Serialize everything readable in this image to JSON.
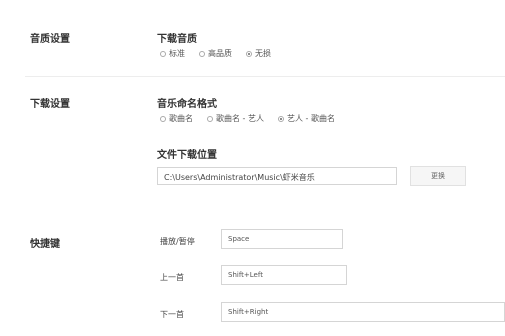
{
  "audio_quality": {
    "section_title": "音质设置",
    "subtitle": "下载音质",
    "options": [
      {
        "label": "标准",
        "checked": false
      },
      {
        "label": "高品质",
        "checked": false
      },
      {
        "label": "无损",
        "checked": true
      }
    ]
  },
  "download": {
    "section_title": "下载设置",
    "naming_title": "音乐命名格式",
    "naming_options": [
      {
        "label": "歌曲名",
        "checked": false
      },
      {
        "label": "歌曲名 - 艺人",
        "checked": false
      },
      {
        "label": "艺人 - 歌曲名",
        "checked": true
      }
    ],
    "location_title": "文件下载位置",
    "path": "C:\\Users\\Administrator\\Music\\虾米音乐",
    "change_label": "更换"
  },
  "shortcuts": {
    "section_title": "快捷键",
    "items": [
      {
        "label": "播放/暂停",
        "value": "Space"
      },
      {
        "label": "上一首",
        "value": "Shift+Left"
      },
      {
        "label": "下一首",
        "value": "Shift+Right"
      }
    ]
  }
}
